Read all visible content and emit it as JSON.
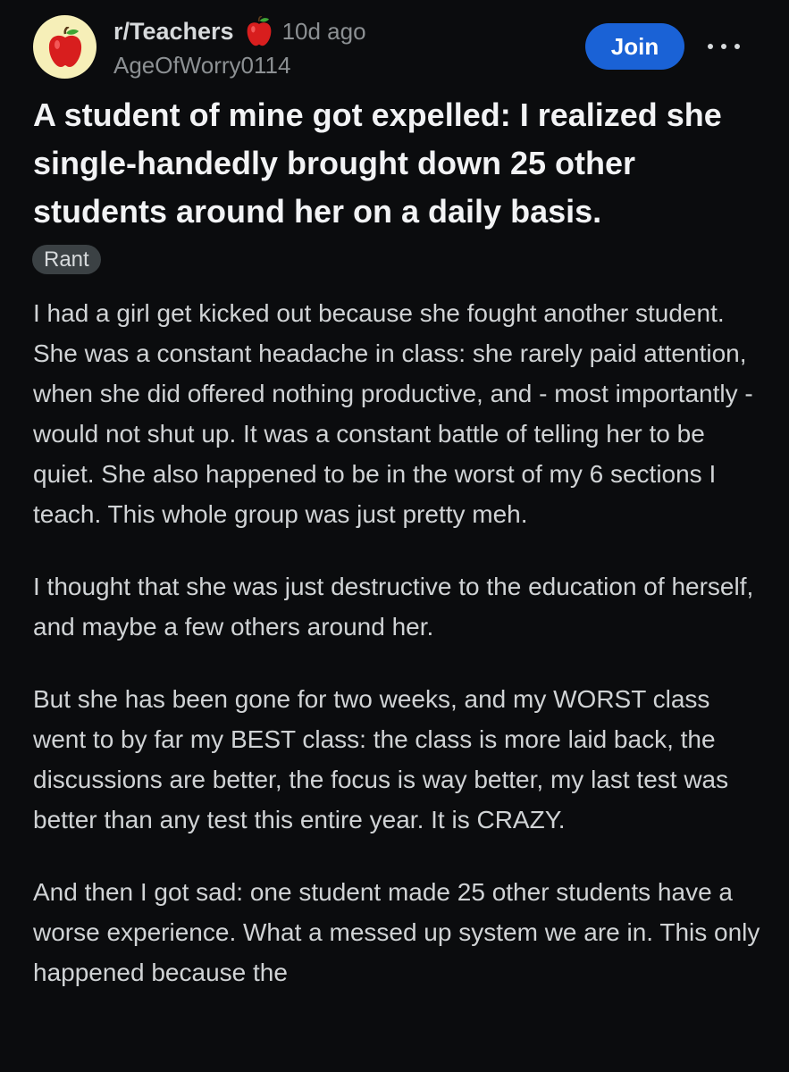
{
  "post": {
    "subreddit": "r/Teachers",
    "subreddit_icon": "apple-icon",
    "time_ago": "10d ago",
    "username": "AgeOfWorry0114",
    "join_label": "Join",
    "more_icon": "more-options-icon",
    "title": "A student of mine got expelled: I realized she single-handedly brought down 25 other students around her on a daily basis.",
    "flair": "Rant",
    "paragraphs": [
      "I had a girl get kicked out because she fought another student. She was a constant headache in class: she rarely paid attention, when she did offered nothing productive, and - most importantly - would not shut up. It was a constant battle of telling her to be quiet. She also happened to be in the worst of my 6 sections I teach. This whole group was just pretty meh.",
      "I thought that she was just destructive to the education of herself, and maybe a few others around her.",
      "But she has been gone for two weeks, and my WORST class went to by far my BEST class: the class is more laid back, the discussions are better, the focus is way better, my last test was better than any test this entire year. It is CRAZY.",
      "And then I got sad: one student made 25 other students have a worse experience. What a messed up system we are in. This only happened because the"
    ]
  },
  "colors": {
    "background": "#0b0c0e",
    "join_button": "#1a62d6",
    "flair_background": "#3b4144",
    "muted_text": "#8c9093"
  }
}
